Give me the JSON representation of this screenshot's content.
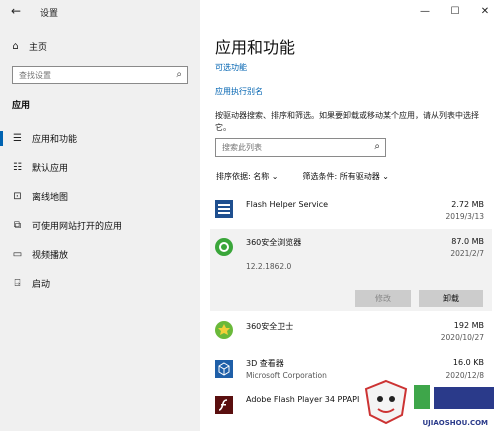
{
  "window": {
    "title": "设置"
  },
  "sidebar": {
    "home_label": "主页",
    "search_placeholder": "查找设置",
    "section_label": "应用",
    "items": [
      {
        "label": "应用和功能",
        "icon": "list-icon"
      },
      {
        "label": "默认应用",
        "icon": "default-apps-icon"
      },
      {
        "label": "离线地图",
        "icon": "map-icon"
      },
      {
        "label": "可使用网站打开的应用",
        "icon": "web-app-icon"
      },
      {
        "label": "视频播放",
        "icon": "video-icon"
      },
      {
        "label": "启动",
        "icon": "startup-icon"
      }
    ]
  },
  "main": {
    "title": "应用和功能",
    "optional_features_link": "可选功能",
    "app_alias_link": "应用执行别名",
    "description": "按驱动器搜索、排序和筛选。如果要卸载或移动某个应用，请从列表中选择它。",
    "search_placeholder": "搜索此列表",
    "sort_label": "排序依据:",
    "sort_value": "名称",
    "filter_label": "筛选条件:",
    "filter_value": "所有驱动器",
    "apps": [
      {
        "name": "Flash Helper Service",
        "size": "2.72 MB",
        "date": "2019/3/13"
      },
      {
        "name": "360安全浏览器",
        "size": "87.0 MB",
        "date": "2021/2/7",
        "version": "12.2.1862.0",
        "modify_label": "修改",
        "uninstall_label": "卸载"
      },
      {
        "name": "360安全卫士",
        "size": "192 MB",
        "date": "2020/10/27"
      },
      {
        "name": "3D 查看器",
        "size": "16.0 KB",
        "date": "2020/12/8",
        "publisher": "Microsoft Corporation"
      },
      {
        "name": "Adobe Flash Player 34 PPAPI",
        "size": "",
        "date": ""
      }
    ]
  },
  "watermark": {
    "text": "UJIAOSHOU.COM"
  },
  "colors": {
    "accent": "#0063b1",
    "sidebar_bg": "#f0f0f0",
    "selected_row": "#f2f2f2"
  }
}
